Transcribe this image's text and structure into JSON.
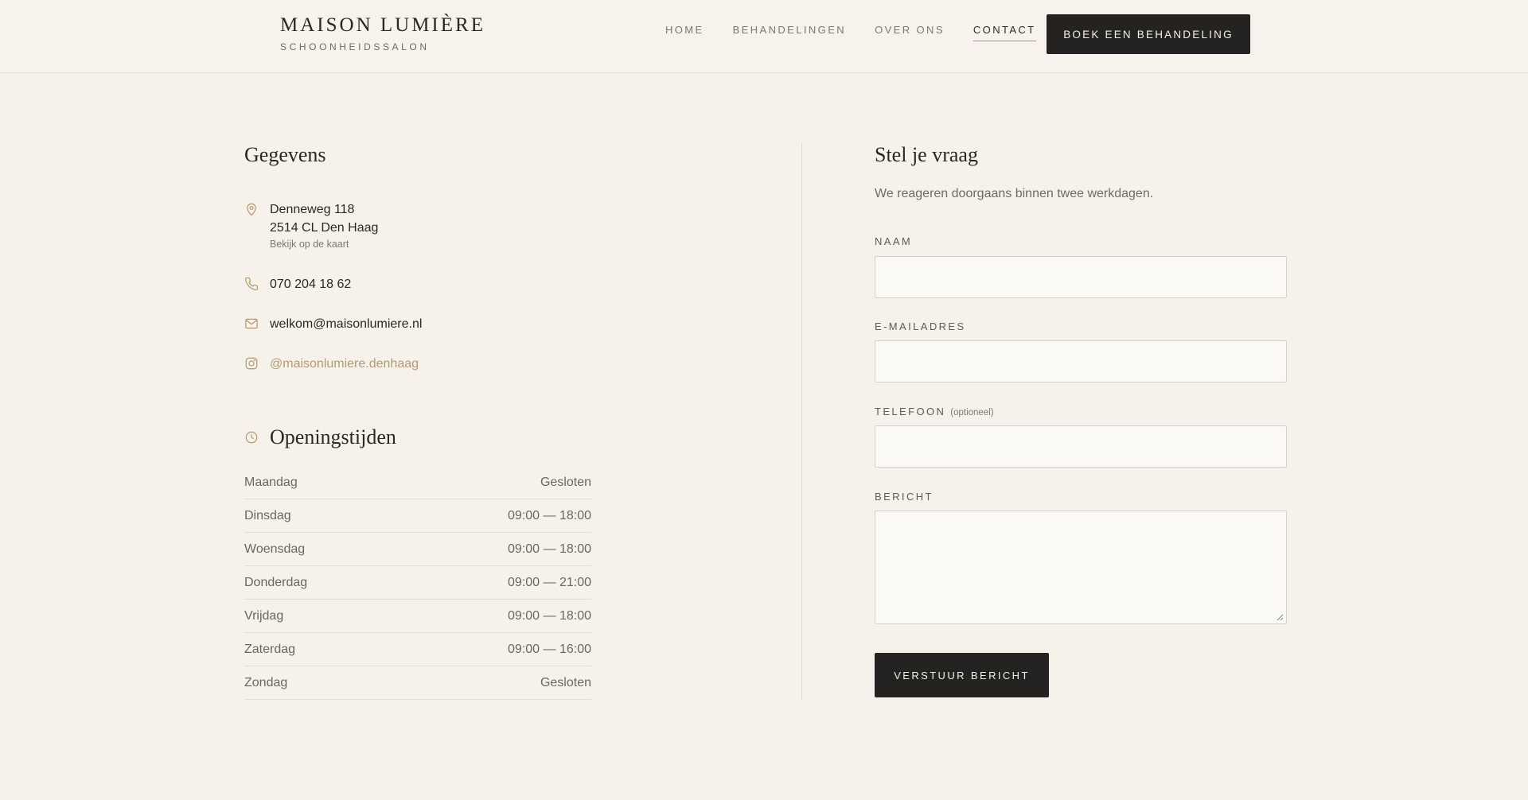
{
  "brand": {
    "name": "MAISON LUMIÈRE",
    "tagline": "SCHOONHEIDSSALON"
  },
  "nav": {
    "items": [
      {
        "label": "HOME"
      },
      {
        "label": "BEHANDELINGEN"
      },
      {
        "label": "OVER ONS"
      },
      {
        "label": "CONTACT"
      }
    ],
    "active": "CONTACT",
    "cta_label": "BOEK EEN BEHANDELING"
  },
  "details": {
    "title": "Gegevens",
    "address_line1": "Denneweg 118",
    "address_line2": "2514 CL Den Haag",
    "map_link": "Bekijk op de kaart",
    "phone": "070 204 18 62",
    "email": "welkom@maisonlumiere.nl",
    "instagram": "@maisonlumiere.denhaag",
    "icons": [
      "map-pin-icon",
      "phone-icon",
      "mail-icon",
      "instagram-icon"
    ]
  },
  "hours": {
    "title": "Openingstijden",
    "icon": "clock-icon",
    "rows": [
      {
        "day": "Maandag",
        "time": "Gesloten"
      },
      {
        "day": "Dinsdag",
        "time": "09:00 — 18:00"
      },
      {
        "day": "Woensdag",
        "time": "09:00 — 18:00"
      },
      {
        "day": "Donderdag",
        "time": "09:00 — 21:00"
      },
      {
        "day": "Vrijdag",
        "time": "09:00 — 18:00"
      },
      {
        "day": "Zaterdag",
        "time": "09:00 — 16:00"
      },
      {
        "day": "Zondag",
        "time": "Gesloten"
      }
    ]
  },
  "form": {
    "title": "Stel je vraag",
    "intro": "We reageren doorgaans binnen twee werkdagen.",
    "name_label": "NAAM",
    "name_value": "",
    "email_label": "E-MAILADRES",
    "email_value": "",
    "phone_label": "TELEFOON",
    "phone_optional": "(optioneel)",
    "phone_value": "",
    "message_label": "BERICHT",
    "message_value": "",
    "submit_label": "VERSTUUR BERICHT"
  },
  "colors": {
    "background": "#f6f2eb",
    "dark": "#252321",
    "accent_gold": "#b39a6e"
  }
}
